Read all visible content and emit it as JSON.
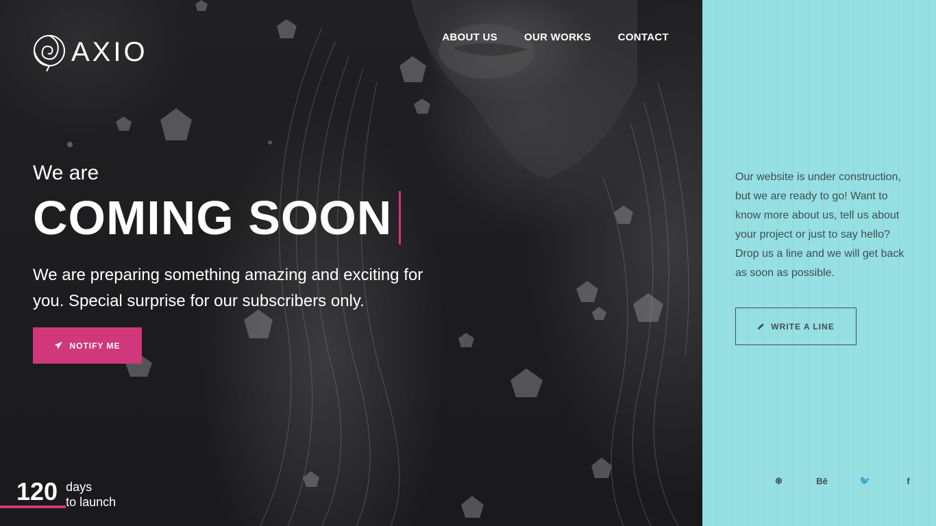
{
  "brand": {
    "name": "AXIO"
  },
  "nav": {
    "items": [
      "ABOUT US",
      "OUR WORKS",
      "CONTACT"
    ]
  },
  "hero": {
    "intro": "We are",
    "headline": "COMING SOON",
    "description": "We are preparing something amazing and exciting for you. Special surprise for our subscribers only.",
    "notify_label": "NOTIFY ME"
  },
  "countdown": {
    "value": "120",
    "unit": "days",
    "caption": "to launch"
  },
  "sidebar": {
    "text": "Our website is under construction, but we are ready to go! Want to know more about us, tell us about your project or just to say hello? Drop us a line and we will get back as soon as possible.",
    "write_label": "WRITE A LINE",
    "social": [
      {
        "name": "dribbble-icon",
        "glyph": "⊛"
      },
      {
        "name": "behance-icon",
        "glyph": "Bē"
      },
      {
        "name": "twitter-icon",
        "glyph": "🐦"
      },
      {
        "name": "facebook-icon",
        "glyph": "f"
      }
    ]
  },
  "colors": {
    "accent": "#d1377b",
    "panel": "#96dfe3",
    "panel_text": "#3d4f52"
  }
}
